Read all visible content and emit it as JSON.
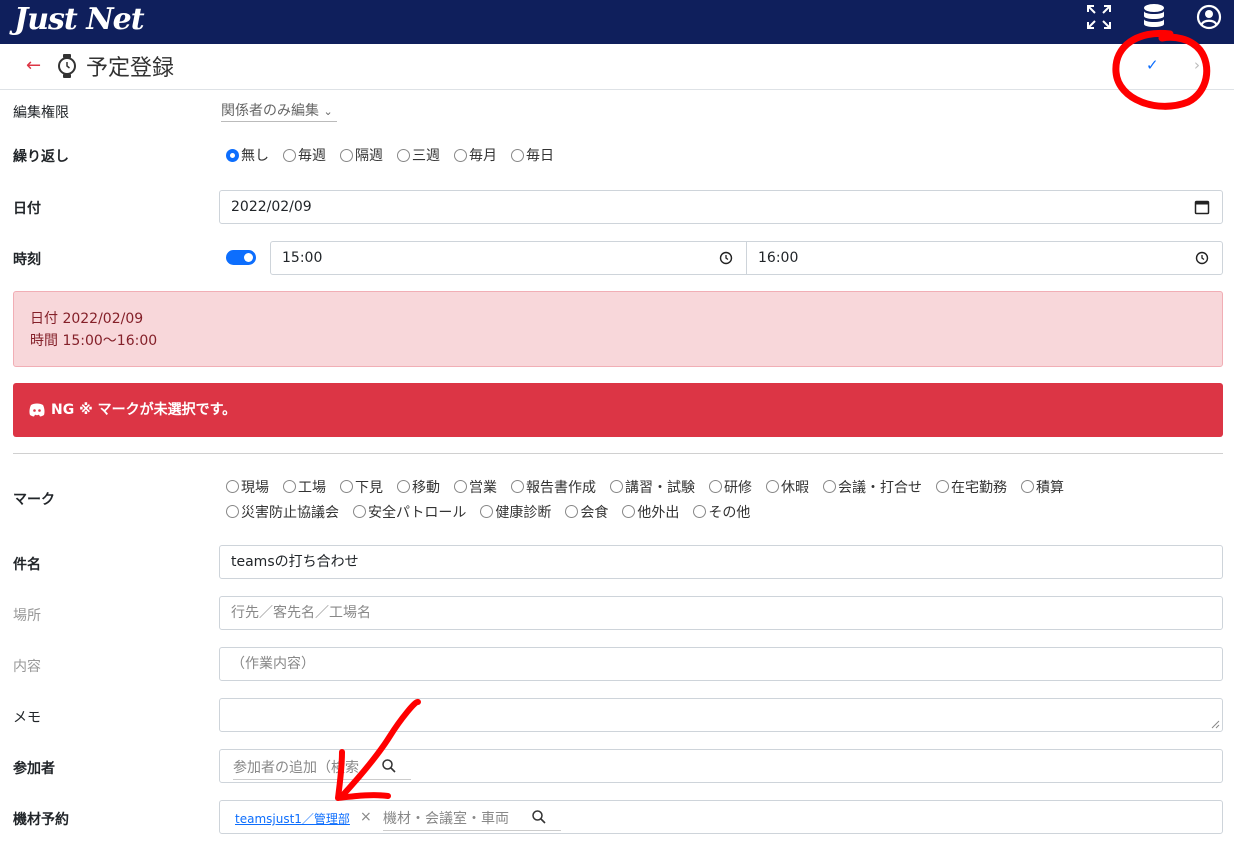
{
  "header": {
    "logo": "Just Net",
    "icons": [
      "fullscreen-icon",
      "database-icon",
      "account-icon"
    ]
  },
  "titlebar": {
    "back": "←",
    "title": "予定登録",
    "check": "✓",
    "next": "›"
  },
  "form": {
    "permission": {
      "label": "編集権限",
      "value": "関係者のみ編集"
    },
    "repeat": {
      "label": "繰り返し",
      "options": [
        "無し",
        "毎週",
        "隔週",
        "三週",
        "毎月",
        "毎日"
      ],
      "selected": "無し"
    },
    "date": {
      "label": "日付",
      "value": "2022/02/09"
    },
    "time": {
      "label": "時刻",
      "start": "15:00",
      "end": "16:00",
      "toggle_on": true
    },
    "summary": {
      "date_line": "日付 2022/02/09",
      "time_line": "時間 15:00〜16:00"
    },
    "error": {
      "text": "NG ※ マークが未選択です。"
    },
    "mark": {
      "label": "マーク",
      "row1": [
        "現場",
        "工場",
        "下見",
        "移動",
        "営業",
        "報告書作成",
        "講習・試験",
        "研修",
        "休暇",
        "会議・打合せ",
        "在宅勤務",
        "積算"
      ],
      "row2": [
        "災害防止協議会",
        "安全パトロール",
        "健康診断",
        "会食",
        "他外出",
        "その他"
      ]
    },
    "subject": {
      "label": "件名",
      "value": "teamsの打ち合わせ"
    },
    "place": {
      "label": "場所",
      "placeholder": "行先／客先名／工場名"
    },
    "content": {
      "label": "内容",
      "placeholder": "（作業内容）"
    },
    "memo": {
      "label": "メモ",
      "value": ""
    },
    "participants": {
      "label": "参加者",
      "placeholder": "参加者の追加（検索"
    },
    "equipment": {
      "label": "機材予約",
      "tag": "teamsjust1／管理部",
      "remove": "×",
      "placeholder": "機材・会議室・車両"
    }
  },
  "colors": {
    "header_bg": "#0f1f5c",
    "accent": "#0d6efd",
    "danger": "#dc3545",
    "alert_pink": "#f8d7da"
  }
}
